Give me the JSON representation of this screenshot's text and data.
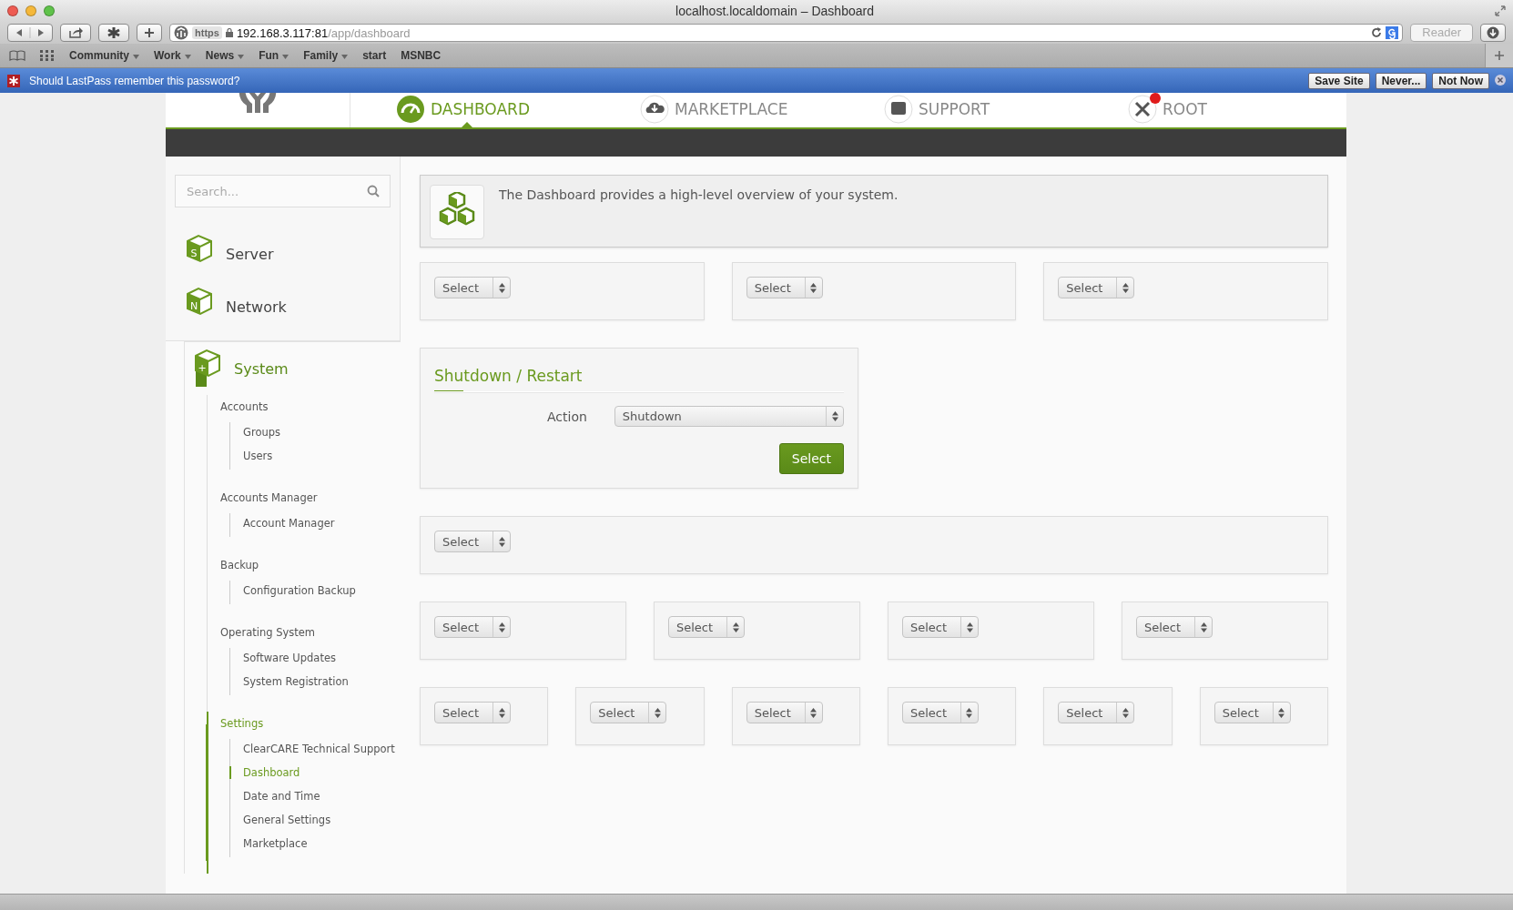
{
  "browser": {
    "title": "localhost.localdomain – Dashboard",
    "scheme": "https",
    "url_host": "192.168.3.117:81",
    "url_path": "/app/dashboard",
    "reader": "Reader",
    "bookmarks": [
      {
        "label": "Community",
        "dropdown": true
      },
      {
        "label": "Work",
        "dropdown": true
      },
      {
        "label": "News",
        "dropdown": true
      },
      {
        "label": "Fun",
        "dropdown": true
      },
      {
        "label": "Family",
        "dropdown": true
      },
      {
        "label": "start",
        "dropdown": false
      },
      {
        "label": "MSNBC",
        "dropdown": false
      }
    ]
  },
  "lastpass": {
    "message": "Should LastPass remember this password?",
    "buttons": [
      "Save Site",
      "Never...",
      "Not Now"
    ]
  },
  "nav": [
    {
      "label": "DASHBOARD",
      "selected": true
    },
    {
      "label": "MARKETPLACE",
      "selected": false
    },
    {
      "label": "SUPPORT",
      "selected": false
    },
    {
      "label": "ROOT",
      "selected": false
    }
  ],
  "sidebar": {
    "search": {
      "placeholder": "Search..."
    },
    "categories": [
      {
        "label": "Server",
        "letter": "S",
        "selected": false,
        "expanded": false
      },
      {
        "label": "Network",
        "letter": "N",
        "selected": false,
        "expanded": false
      },
      {
        "label": "System",
        "letter": "+",
        "selected": true,
        "expanded": true,
        "children": [
          {
            "label": "Accounts",
            "selected": false,
            "children": [
              {
                "label": "Groups",
                "selected": false
              },
              {
                "label": "Users",
                "selected": false
              }
            ]
          },
          {
            "label": "Accounts Manager",
            "selected": false,
            "children": [
              {
                "label": "Account Manager",
                "selected": false
              }
            ]
          },
          {
            "label": "Backup",
            "selected": false,
            "children": [
              {
                "label": "Configuration Backup",
                "selected": false
              }
            ]
          },
          {
            "label": "Operating System",
            "selected": false,
            "children": [
              {
                "label": "Software Updates",
                "selected": false
              },
              {
                "label": "System Registration",
                "selected": false
              }
            ]
          },
          {
            "label": "Settings",
            "selected": true,
            "children": [
              {
                "label": "ClearCARE Technical Support",
                "selected": false
              },
              {
                "label": "Dashboard",
                "selected": true
              },
              {
                "label": "Date and Time",
                "selected": false
              },
              {
                "label": "General Settings",
                "selected": false
              },
              {
                "label": "Marketplace",
                "selected": false
              }
            ]
          }
        ]
      }
    ]
  },
  "intro": "The Dashboard provides a high-level overview of your system.",
  "rows": [
    {
      "kind": "selects",
      "widgets": [
        "Select",
        "Select",
        "Select"
      ]
    },
    {
      "kind": "form",
      "title": "Shutdown / Restart",
      "field_label": "Action",
      "field_value": "Shutdown",
      "button": "Select"
    },
    {
      "kind": "selects",
      "widgets": [
        "Select"
      ]
    },
    {
      "kind": "selects",
      "widgets": [
        "Select",
        "Select",
        "Select",
        "Select"
      ]
    },
    {
      "kind": "selects",
      "widgets": [
        "Select",
        "Select",
        "Select",
        "Select",
        "Select",
        "Select"
      ]
    }
  ]
}
